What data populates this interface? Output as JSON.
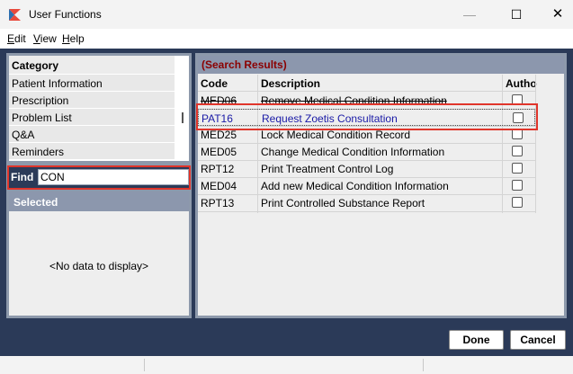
{
  "window": {
    "title": "User Functions",
    "minimize_icon": "minimize-icon",
    "maximize_icon": "maximize-icon",
    "close_icon": "close-icon",
    "minimize_glyph": "—",
    "maximize_glyph": "☐",
    "close_glyph": "✕"
  },
  "menu": {
    "items": [
      {
        "label": "Edit"
      },
      {
        "label": "View"
      },
      {
        "label": "Help"
      }
    ]
  },
  "category": {
    "header": "Category",
    "items": [
      {
        "label": "Patient Information"
      },
      {
        "label": "Prescription"
      },
      {
        "label": "Problem List"
      },
      {
        "label": "Q&A"
      },
      {
        "label": "Reminders"
      }
    ]
  },
  "find": {
    "label": "Find",
    "value": "CON"
  },
  "selected": {
    "header": "Selected",
    "empty_text": "<No data to display>"
  },
  "results": {
    "header": "(Search Results)",
    "columns": [
      "Code",
      "Description",
      "Autho"
    ],
    "rows": [
      {
        "code": "MED06",
        "description": "Remove Medical Condition Information",
        "authorized": false
      },
      {
        "code": "PAT16",
        "description": "Request Zoetis Consultation",
        "authorized": false
      },
      {
        "code": "MED25",
        "description": "Lock Medical Condition Record",
        "authorized": false
      },
      {
        "code": "MED05",
        "description": "Change Medical Condition Information",
        "authorized": false
      },
      {
        "code": "RPT12",
        "description": "Print Treatment Control Log",
        "authorized": false
      },
      {
        "code": "MED04",
        "description": "Add new Medical Condition Information",
        "authorized": false
      },
      {
        "code": "RPT13",
        "description": "Print Controlled Substance Report",
        "authorized": false
      }
    ]
  },
  "buttons": {
    "done": "Done",
    "cancel": "Cancel"
  },
  "colors": {
    "accent_red": "#e0352b",
    "panel_bg": "#2b3a58",
    "header_bg": "#8c97ad"
  }
}
